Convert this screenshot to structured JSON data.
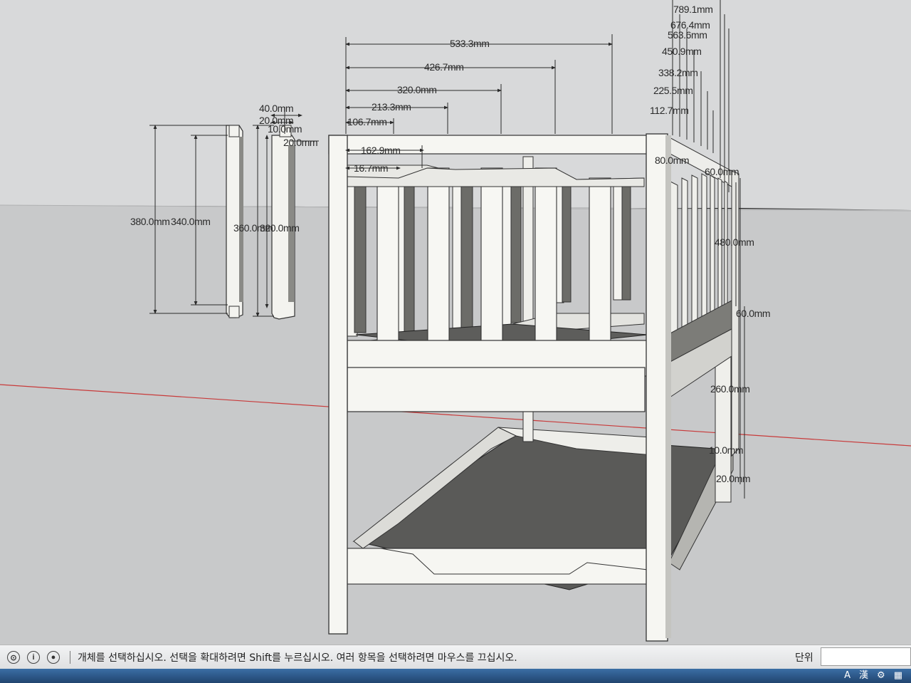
{
  "dimensions": {
    "top_widths": [
      "533.3mm",
      "426.7mm",
      "320.0mm",
      "213.3mm",
      "106.7mm"
    ],
    "front_inner": [
      "162.9mm",
      "16.7mm"
    ],
    "side_cascade": [
      "789.1mm",
      "676.4mm",
      "563.6mm",
      "450.9mm",
      "338.2mm",
      "225.5mm",
      "112.7mm"
    ],
    "small_part": [
      "40.0mm",
      "20.0mm",
      "10.0mm",
      "20.0mm"
    ],
    "part_heights": [
      "380.0mm",
      "340.0mm",
      "360.0mm",
      "320.0mm"
    ],
    "side_labels": [
      "80.0mm",
      "60.0mm",
      "480.0mm",
      "260.0mm",
      "10.0mm",
      "20.0mm"
    ]
  },
  "status": {
    "message": "개체를 선택하십시오. 선택을 확대하려면 Shift를 누르십시오. 여러 항목을 선택하려면 마우스를 끄십시오.",
    "units_label": "단위"
  },
  "icons": {
    "geo": "geo-location-icon",
    "info": "info-icon",
    "user": "user-account-icon"
  },
  "taskbar": {
    "ime_a": "A",
    "ime_han": "漢"
  },
  "colors": {
    "ground": "#c9cacb",
    "sky": "#d7d8d9",
    "board": "#f5f5f1",
    "shadow": "#6e6e6a",
    "floor": "#5b5b59",
    "dim_line": "#2a2a2a",
    "red_axis": "#cc3a3a"
  }
}
